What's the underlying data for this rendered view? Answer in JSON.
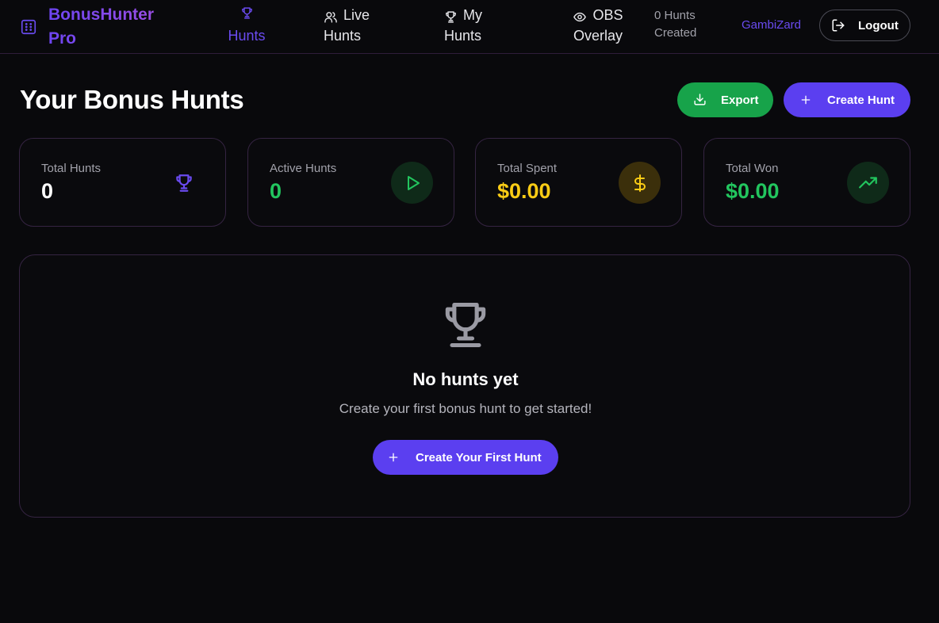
{
  "app": {
    "name": "BonusHunter Pro",
    "logo_icon": "dice-icon"
  },
  "nav": {
    "items": [
      {
        "label": "Hunts",
        "icon": "trophy-icon",
        "active": true
      },
      {
        "label": "Live Hunts",
        "icon": "users-icon",
        "active": false
      },
      {
        "label": "My Hunts",
        "icon": "trophy-icon",
        "active": false
      },
      {
        "label": "OBS Overlay",
        "icon": "eye-icon",
        "active": false
      }
    ],
    "hunts_created": "0 Hunts Created",
    "username": "GambiZard",
    "logout_label": "Logout"
  },
  "page": {
    "title": "Your Bonus Hunts",
    "export_label": "Export",
    "create_label": "Create Hunt"
  },
  "stats": [
    {
      "label": "Total Hunts",
      "value": "0",
      "icon": "trophy-icon",
      "value_color": "#ffffff",
      "icon_color": "#6a4bf0",
      "circle_bg": "transparent"
    },
    {
      "label": "Active Hunts",
      "value": "0",
      "icon": "play-icon",
      "value_color": "#22c55e",
      "icon_color": "#22c55e",
      "circle_bg": "#0f2a19"
    },
    {
      "label": "Total Spent",
      "value": "$0.00",
      "icon": "dollar-icon",
      "value_color": "#facc15",
      "icon_color": "#facc15",
      "circle_bg": "#3b2f0b"
    },
    {
      "label": "Total Won",
      "value": "$0.00",
      "icon": "trending-up-icon",
      "value_color": "#22c55e",
      "icon_color": "#22c55e",
      "circle_bg": "#0f2a19"
    }
  ],
  "empty_state": {
    "icon": "trophy-icon",
    "title": "No hunts yet",
    "subtitle": "Create your first bonus hunt to get started!",
    "button_label": "Create Your First Hunt"
  },
  "colors": {
    "background": "#09090c",
    "accent": "#5b3ff0",
    "success": "#17a34a",
    "border": "#352442"
  }
}
